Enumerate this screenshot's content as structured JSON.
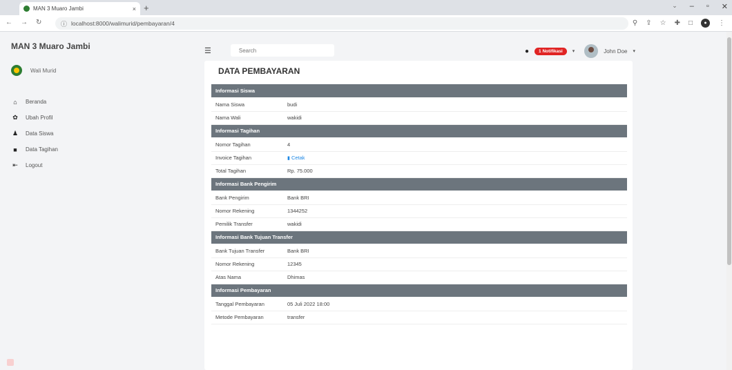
{
  "browser": {
    "tab_title": "MAN 3 Muaro Jambi",
    "tab_close": "×",
    "new_tab": "+",
    "url": "localhost:8000/walimurid/pembayaran/4"
  },
  "sidebar": {
    "brand": "MAN 3 Muaro Jambi",
    "user_name": "Wali Murid",
    "items": [
      {
        "icon": "home-icon",
        "glyph": "⌂",
        "label": "Beranda"
      },
      {
        "icon": "gear-icon",
        "glyph": "✿",
        "label": "Ubah Profil"
      },
      {
        "icon": "user-icon",
        "glyph": "♟",
        "label": "Data Siswa"
      },
      {
        "icon": "book-icon",
        "glyph": "■",
        "label": "Data Tagihan"
      },
      {
        "icon": "logout-icon",
        "glyph": "⇤",
        "label": "Logout"
      }
    ]
  },
  "topbar": {
    "search_placeholder": "Search",
    "badge": "1 Notifikasi",
    "user_name": "John Doe"
  },
  "page": {
    "title": "DATA PEMBAYARAN",
    "sections": [
      {
        "header": "Informasi Siswa",
        "rows": [
          {
            "label": "Nama Siswa",
            "value": "budi"
          },
          {
            "label": "Nama Wali",
            "value": "wakidi"
          }
        ]
      },
      {
        "header": "Informasi Tagihan",
        "rows": [
          {
            "label": "Nomor Tagihan",
            "value": "4"
          },
          {
            "label": "Invoice Tagihan",
            "value": "Cetak"
          },
          {
            "label": "Total Tagihan",
            "value": "Rp. 75.000"
          }
        ]
      },
      {
        "header": "Informasi Bank Pengirim",
        "rows": [
          {
            "label": "Bank Pengirim",
            "value": "Bank BRI"
          },
          {
            "label": "Nomor Rekening",
            "value": "1344252"
          },
          {
            "label": "Pemilik Transfer",
            "value": "wakidi"
          }
        ]
      },
      {
        "header": "Informasi Bank Tujuan Transfer",
        "rows": [
          {
            "label": "Bank Tujuan Transfer",
            "value": "Bank BRI"
          },
          {
            "label": "Nomor Rekening",
            "value": "12345"
          },
          {
            "label": "Atas Nama",
            "value": "Dhimas"
          }
        ]
      },
      {
        "header": "Informasi Pembayaran",
        "rows": [
          {
            "label": "Tanggal Pembayaran",
            "value": "05 Juli 2022 18:00"
          },
          {
            "label": "Metode Pembayaran",
            "value": "transfer"
          }
        ]
      }
    ]
  },
  "colors": {
    "section_header_bg": "#6c757d",
    "badge_bg": "#e02424",
    "link": "#1e88e5"
  }
}
